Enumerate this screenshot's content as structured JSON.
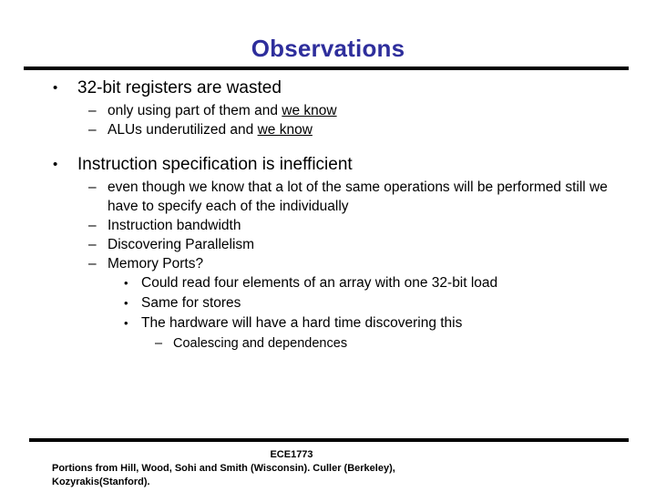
{
  "slide": {
    "title": "Observations",
    "title_color": "#2e2e9c",
    "background_color": "#ffffff",
    "text_color": "#000000",
    "markers": {
      "level1": "•",
      "level2": "–",
      "level3": "•",
      "level4": "–"
    },
    "bullets": {
      "b1": "32-bit registers are wasted",
      "b1s1_pre": "only using part of them and ",
      "b1s1_underline": "we know",
      "b1s2_pre": "ALUs underutilized and ",
      "b1s2_underline": "we know",
      "b2": "Instruction specification is inefficient",
      "b2s1": "even though we know that a lot of the same operations will be performed still we have to specify each of the individually",
      "b2s2": "Instruction bandwidth",
      "b2s3": "Discovering Parallelism",
      "b2s4": "Memory Ports?",
      "b2s4a": "Could read four elements of an array with one 32-bit load",
      "b2s4b": "Same for stores",
      "b2s4c": "The hardware will have a hard time discovering this",
      "b2s4c1": "Coalescing and dependences"
    }
  },
  "footer": {
    "course": "ECE1773",
    "credits_line1": "Portions from Hill, Wood, Sohi and Smith (Wisconsin). Culler (Berkeley),",
    "credits_line2": "Kozyrakis(Stanford)."
  }
}
